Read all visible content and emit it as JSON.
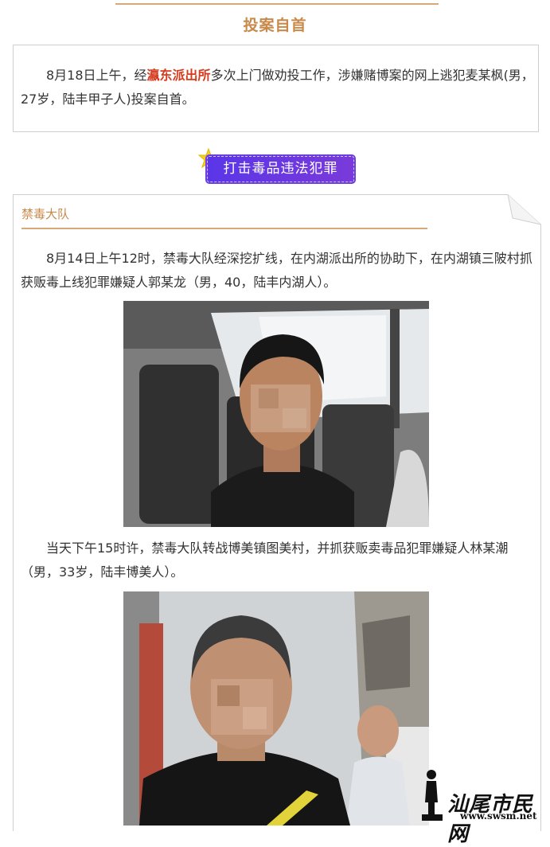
{
  "section1": {
    "title": "投案自首",
    "para_before": "8月18日上午，经",
    "para_highlight": "瀛东派出所",
    "para_after": "多次上门做劝投工作，涉嫌赌博案的网上逃犯麦某枫(男，27岁，陆丰甲子人)投案自首。"
  },
  "banner": {
    "label": "打击毒品违法犯罪"
  },
  "card": {
    "title": "禁毒大队",
    "para1": "8月14日上午12时，禁毒大队经深挖扩线，在内湖派出所的协助下，在内湖镇三陂村抓获贩毒上线犯罪嫌疑人郭某龙（男，40，陆丰内湖人）。",
    "para2": "当天下午15时许，禁毒大队转战博美镇图美村，并抓获贩卖毒品犯罪嫌疑人林某潮（男，33岁，陆丰博美人）。"
  },
  "watermark": {
    "text": "汕尾市民网",
    "url": "www.swsm.net"
  },
  "colors": {
    "accent": "#c8894b",
    "highlight": "#d63b1e",
    "banner": "#6b3ee0"
  }
}
